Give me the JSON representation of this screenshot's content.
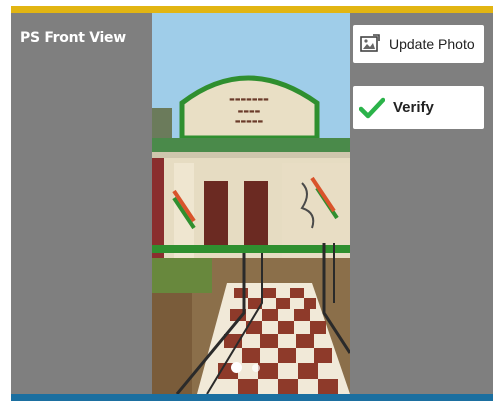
{
  "section": {
    "title": "PS Front View"
  },
  "actions": {
    "update_photo_label": "Update Photo",
    "verify_label": "Verify"
  },
  "photo": {
    "slide_count": 2,
    "active_slide": 1
  },
  "colors": {
    "accent_top": "#e2b512",
    "accent_bottom": "#1b6fa0",
    "panel": "#7f7f7f",
    "verify_check": "#2bb34a"
  },
  "icons": {
    "update_photo": "image-edit-icon",
    "verify": "checkmark-icon"
  }
}
